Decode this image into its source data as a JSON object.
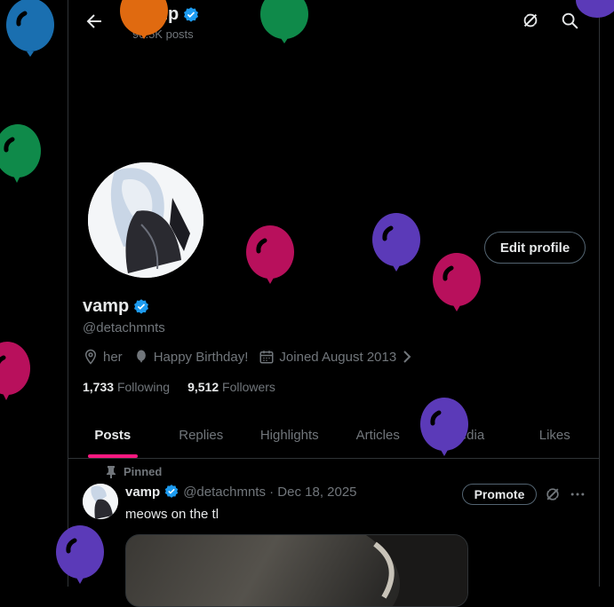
{
  "header": {
    "name": "vamp",
    "posts_count": "90.5K posts"
  },
  "profile": {
    "display_name": "vamp",
    "handle": "@detachmnts",
    "edit_label": "Edit profile",
    "location": "her",
    "birthday": "Happy Birthday!",
    "joined": "Joined August 2013",
    "following_count": "1,733",
    "following_label": "Following",
    "followers_count": "9,512",
    "followers_label": "Followers"
  },
  "tabs": [
    "Posts",
    "Replies",
    "Highlights",
    "Articles",
    "Media",
    "Likes"
  ],
  "active_tab": "Posts",
  "post": {
    "pinned_label": "Pinned",
    "name": "vamp",
    "handle_date": "@detachmnts · Dec 18, 2025",
    "text": "meows on the tl",
    "promote_label": "Promote"
  },
  "colors": {
    "accent": "#f91880",
    "verified": "#1d9bf0",
    "balloon_blue": "#1a6fb0",
    "balloon_green": "#0f8a4a",
    "balloon_magenta": "#b8105c",
    "balloon_purple": "#5b3ab8",
    "balloon_orange": "#e06a10"
  }
}
